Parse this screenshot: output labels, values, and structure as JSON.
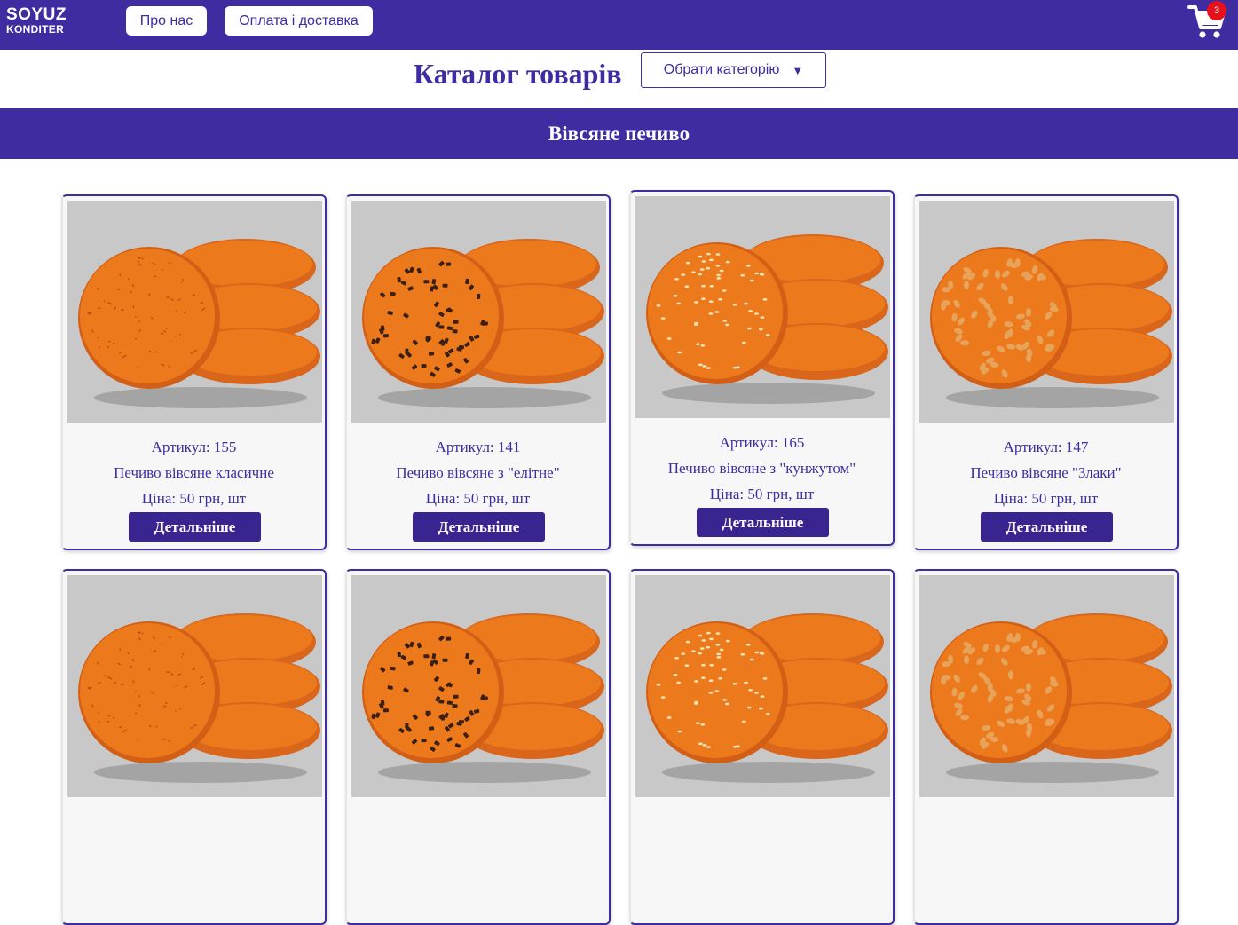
{
  "header": {
    "logo_line1": "SOYUZ",
    "logo_line2": "KONDITER",
    "nav": [
      {
        "label": "Про нас"
      },
      {
        "label": "Оплата і доставка"
      }
    ],
    "cart_count": "3"
  },
  "catalog": {
    "title": "Каталог товарів",
    "select_label": "Обрати категорію",
    "select_arrow": "▼"
  },
  "category": {
    "name": "Вівсяне печиво"
  },
  "products": [
    {
      "article": "Артикул: 155",
      "name": "Печиво вівсяне класичне",
      "price": "Ціна: 50 грн, шт",
      "button": "Детальніше",
      "topping": "plain"
    },
    {
      "article": "Артикул: 141",
      "name": "Печиво вівсяне з \"елітне\"",
      "price": "Ціна: 50 грн, шт",
      "button": "Детальніше",
      "topping": "chocolate"
    },
    {
      "article": "Артикул: 165",
      "name": "Печиво вівсяне з \"кунжутом\"",
      "price": "Ціна: 50 грн, шт",
      "button": "Детальніше",
      "topping": "sesame"
    },
    {
      "article": "Артикул: 147",
      "name": "Печиво вівсяне \"Злаки\"",
      "price": "Ціна: 50 грн, шт",
      "button": "Детальніше",
      "topping": "oats"
    }
  ],
  "colors": {
    "brand": "#3f2ca0",
    "badge": "#e8101a",
    "cookie": "#ec7a1c"
  }
}
